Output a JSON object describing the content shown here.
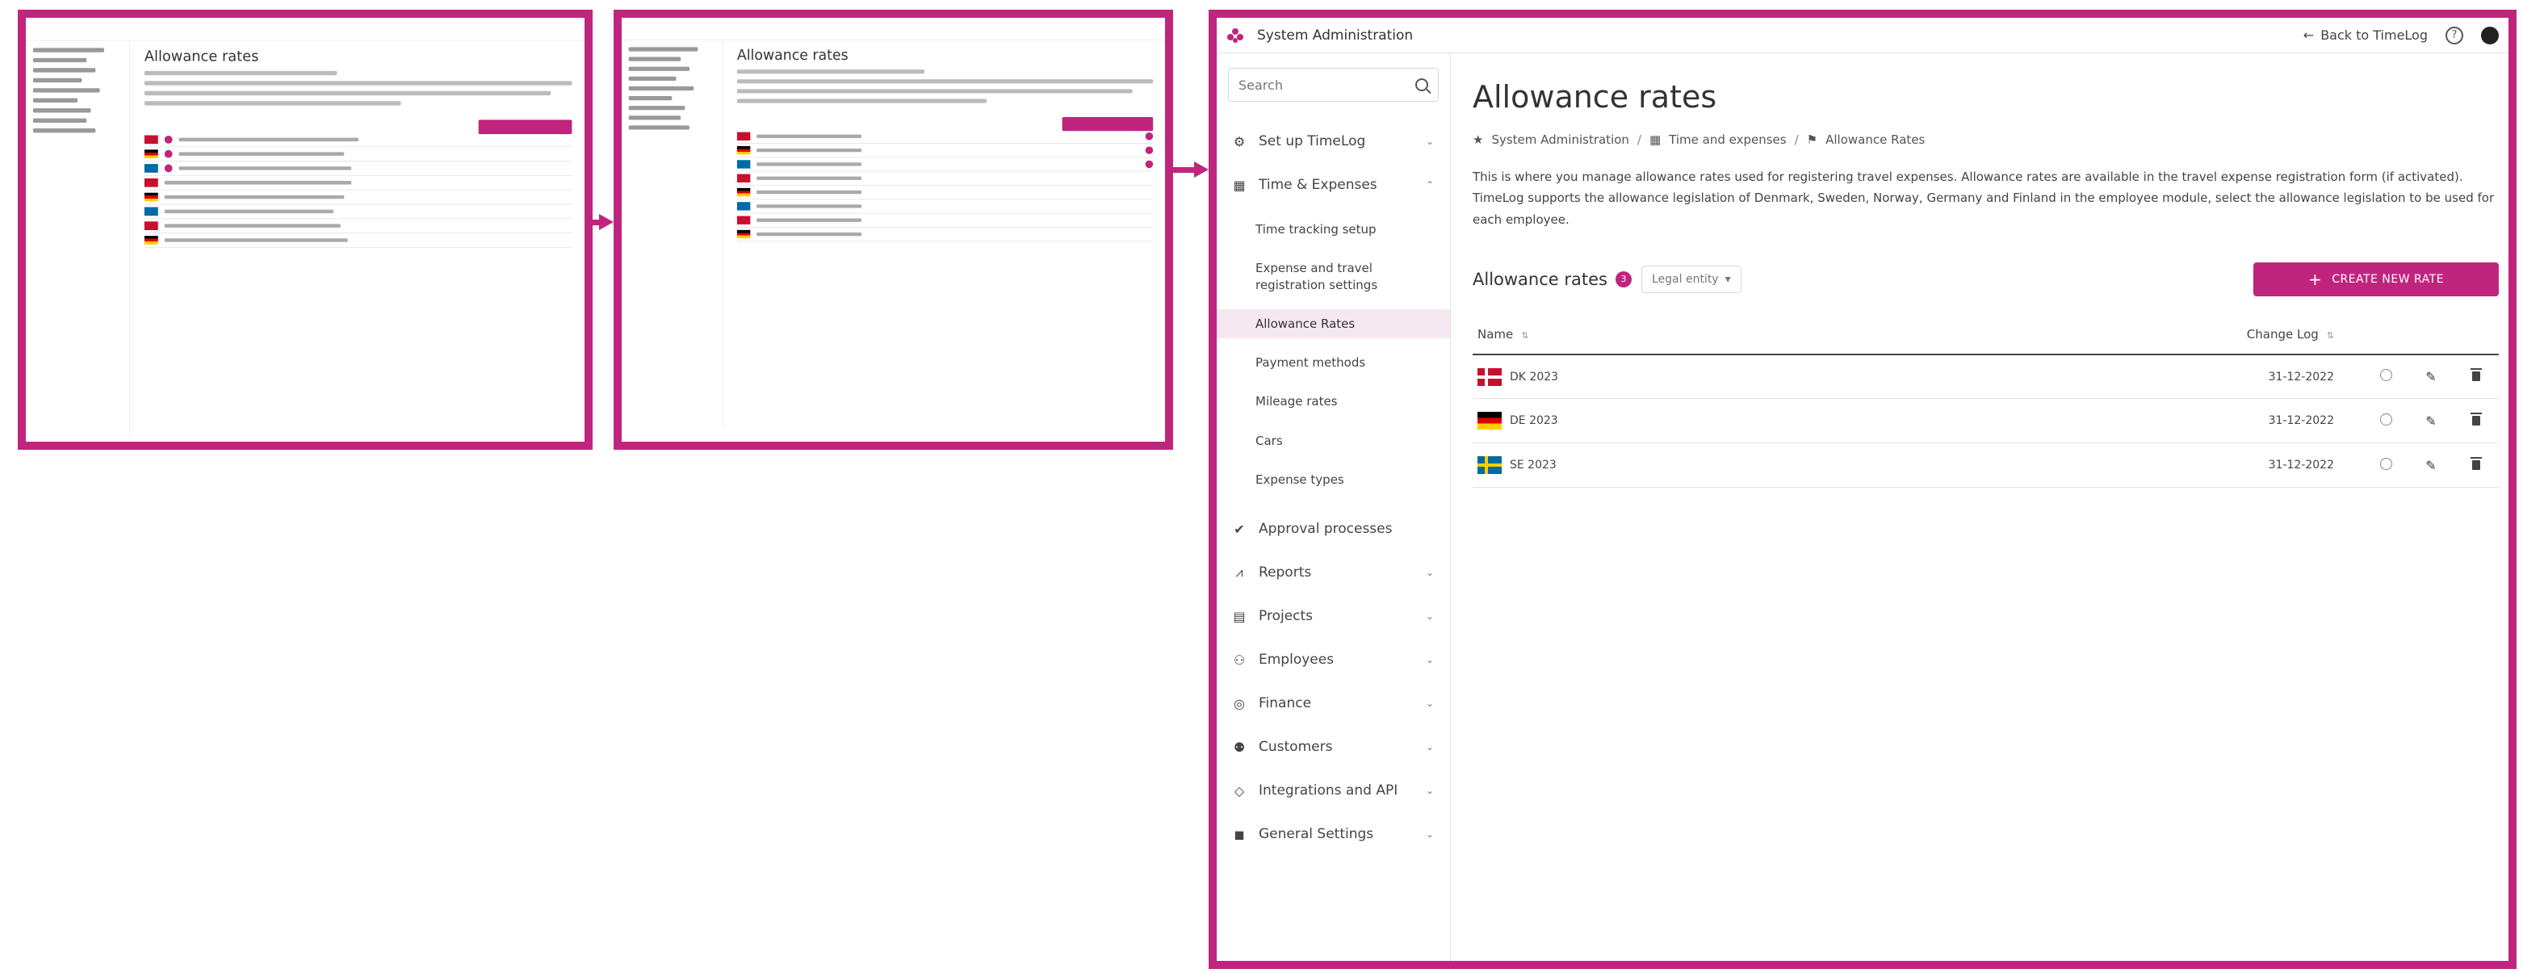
{
  "colors": {
    "accent": "#c0257e"
  },
  "header": {
    "app_title": "System Administration",
    "back_link": "Back to TimeLog",
    "help": "?"
  },
  "search": {
    "placeholder": "Search"
  },
  "sidebar": {
    "items": [
      {
        "label": "Set up TimeLog",
        "icon": "gear-icon"
      },
      {
        "label": "Time & Expenses",
        "icon": "calendar-icon"
      },
      {
        "label": "Approval processes",
        "icon": "check-icon"
      },
      {
        "label": "Reports",
        "icon": "chart-icon"
      },
      {
        "label": "Projects",
        "icon": "clipboard-icon"
      },
      {
        "label": "Employees",
        "icon": "people-icon"
      },
      {
        "label": "Finance",
        "icon": "coin-icon"
      },
      {
        "label": "Customers",
        "icon": "group-icon"
      },
      {
        "label": "Integrations and API",
        "icon": "plug-icon"
      },
      {
        "label": "General Settings",
        "icon": "settings-icon"
      }
    ],
    "sub_items": [
      "Time tracking setup",
      "Expense and travel registration settings",
      "Allowance Rates",
      "Payment methods",
      "Mileage rates",
      "Cars",
      "Expense types"
    ]
  },
  "main": {
    "title": "Allowance rates",
    "breadcrumb": [
      "System Administration",
      "Time and expenses",
      "Allowance Rates"
    ],
    "intro": "This is where you manage allowance rates used for registering travel expenses. Allowance rates are available in the travel expense registration form (if activated). TimeLog supports the allowance legislation of Denmark, Sweden, Norway, Germany and Finland in the employee module, select the allowance legislation to be used for each employee.",
    "section_title": "Allowance rates",
    "count": "3",
    "filter_label": "Legal entity",
    "create_button": "CREATE NEW RATE",
    "columns": {
      "name": "Name",
      "change_log": "Change Log"
    },
    "rows": [
      {
        "flag": "dk",
        "name": "DK 2023",
        "date": "31-12-2022"
      },
      {
        "flag": "de",
        "name": "DE 2023",
        "date": "31-12-2022"
      },
      {
        "flag": "se",
        "name": "SE 2023",
        "date": "31-12-2022"
      }
    ]
  }
}
